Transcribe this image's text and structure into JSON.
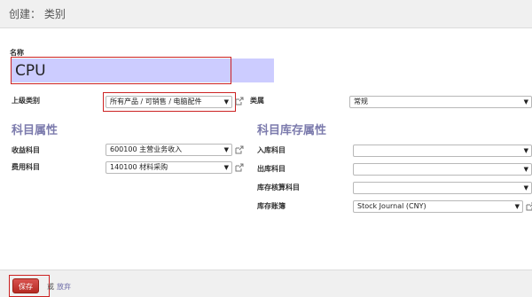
{
  "header": {
    "title": "创建： 类别"
  },
  "form": {
    "name_label": "名称",
    "name_value": "CPU",
    "parent_label": "上级类别",
    "parent_value": "所有产品 / 可销售 / 电脑配件",
    "type_label": "类属",
    "type_value": "常规"
  },
  "accounts_section": {
    "title": "科目属性",
    "income_label": "收益科目",
    "income_value": "600100 主营业务收入",
    "expense_label": "费用科目",
    "expense_value": "140100 材料采购"
  },
  "stock_section": {
    "title": "科目库存属性",
    "input_label": "入库科目",
    "input_value": "",
    "output_label": "出库科目",
    "output_value": "",
    "valuation_label": "库存核算科目",
    "valuation_value": "",
    "journal_label": "库存账簿",
    "journal_value": "Stock Journal (CNY)"
  },
  "footer": {
    "save_label": "保存",
    "or_label": "或",
    "discard_label": "放弃"
  },
  "colors": {
    "accent": "#7c7bad",
    "save_button": "#c0392b",
    "highlight": "#cc2222",
    "name_field_bg": "#ccccff"
  },
  "icons": {
    "dropdown": "caret-down-icon",
    "external_link": "external-link-icon"
  }
}
